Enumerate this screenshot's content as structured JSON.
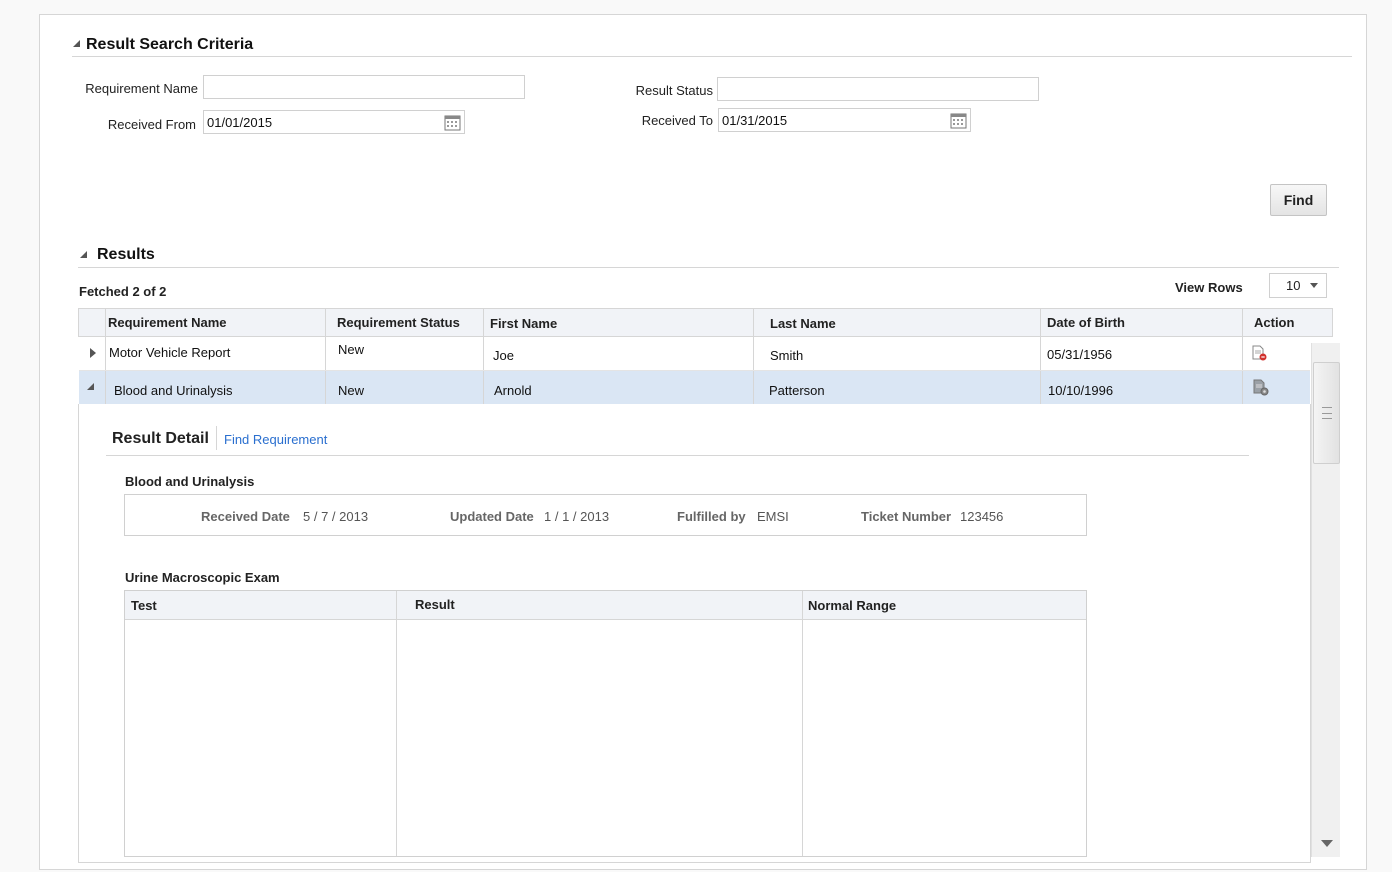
{
  "search": {
    "title": "Result Search Criteria",
    "requirement_name_label": "Requirement Name",
    "requirement_name_value": "",
    "result_status_label": "Result Status",
    "result_status_value": "",
    "received_from_label": "Received From",
    "received_from_value": "01/01/2015",
    "received_to_label": "Received To",
    "received_to_value": "01/31/2015",
    "find_label": "Find"
  },
  "results": {
    "title": "Results",
    "fetched": "Fetched 2 of 2",
    "view_rows_label": "View Rows",
    "view_rows_value": "10",
    "columns": [
      "Requirement Name",
      "Requirement Status",
      "First Name",
      "Last Name",
      "Date of Birth",
      "Action"
    ],
    "rows": [
      {
        "requirement_name": "Motor Vehicle Report",
        "status": "New",
        "first_name": "Joe",
        "last_name": "Smith",
        "dob": "05/31/1956",
        "action_icon": "delete-document-icon"
      },
      {
        "requirement_name": "Blood and Urinalysis",
        "status": "New",
        "first_name": "Arnold",
        "last_name": "Patterson",
        "dob": "10/10/1996",
        "action_icon": "settings-document-icon"
      }
    ]
  },
  "detail": {
    "title": "Result Detail",
    "find_requirement_link": "Find Requirement",
    "requirement_title": "Blood and Urinalysis",
    "received_date_label": "Received Date",
    "received_date_value": "5 / 7 / 2013",
    "updated_date_label": "Updated Date",
    "updated_date_value": "1 / 1 / 2013",
    "fulfilled_by_label": "Fulfilled by",
    "fulfilled_by_value": "EMSI",
    "ticket_number_label": "Ticket Number",
    "ticket_number_value": "123456",
    "exam_title": "Urine Macroscopic Exam",
    "exam_columns": [
      "Test",
      "Result",
      "Normal Range"
    ]
  },
  "colors": {
    "link": "#2a6fcf",
    "selected_row": "#dae6f4",
    "header_bg": "#f1f3f7"
  }
}
